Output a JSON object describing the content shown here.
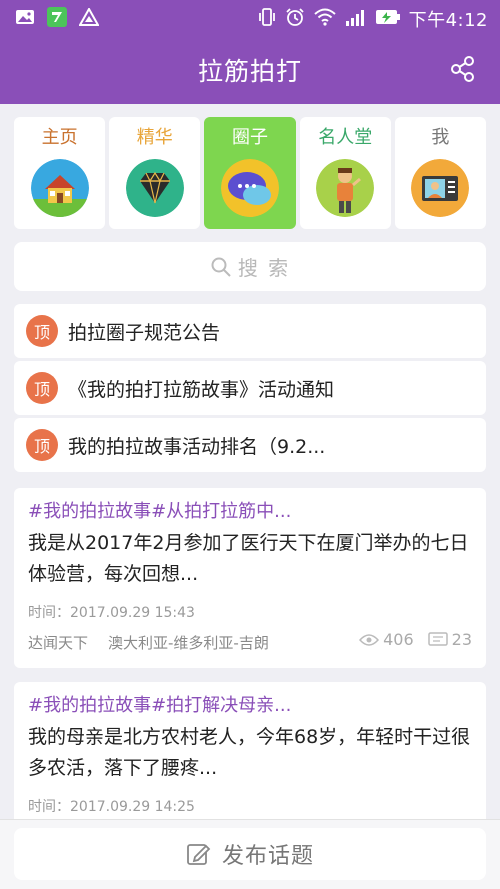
{
  "status_bar": {
    "time": "下午4:12",
    "icons": [
      "gallery-icon",
      "app-icon",
      "warning-icon",
      "vibrate-icon",
      "alarm-icon",
      "wifi-icon",
      "signal-icon",
      "battery-charging-icon"
    ]
  },
  "header": {
    "title": "拉筋拍打",
    "share_icon": "share-icon"
  },
  "tabs": [
    {
      "label": "主页",
      "icon": "house-icon",
      "color": "#c9722e",
      "active": false
    },
    {
      "label": "精华",
      "icon": "gem-icon",
      "color": "#e8a53a",
      "active": false
    },
    {
      "label": "圈子",
      "icon": "chat-bubbles-icon",
      "color": "#ffffff",
      "active": true
    },
    {
      "label": "名人堂",
      "icon": "person-icon",
      "color": "#3aa86a",
      "active": false
    },
    {
      "label": "我",
      "icon": "profile-card-icon",
      "color": "#777777",
      "active": false
    }
  ],
  "search": {
    "placeholder": "搜 索"
  },
  "notices": [
    {
      "badge": "顶",
      "text": "拍拉圈子规范公告"
    },
    {
      "badge": "顶",
      "text": "《我的拍打拉筋故事》活动通知"
    },
    {
      "badge": "顶",
      "text": "我的拍拉故事活动排名（9.2..."
    }
  ],
  "posts": [
    {
      "tags": "#我的拍拉故事#从拍打拉筋中...",
      "body": "我是从2017年2月参加了医行天下在厦门举办的七日体验营，每次回想...",
      "time": "时间：2017.09.29 15:43",
      "author": "达闻天下",
      "location": "澳大利亚-维多利亚-吉朗",
      "views": "406",
      "comments": "23"
    },
    {
      "tags": "#我的拍拉故事#拍打解决母亲...",
      "body": "我的母亲是北方农村老人，今年68岁，年轻时干过很多农活，落下了腰疼...",
      "time": "时间：2017.09.29 14:25"
    }
  ],
  "bottom": {
    "publish_label": "发布话题"
  },
  "colors": {
    "brand": "#8a4fb8",
    "active_tab": "#7ed64f",
    "badge": "#e8734a"
  }
}
